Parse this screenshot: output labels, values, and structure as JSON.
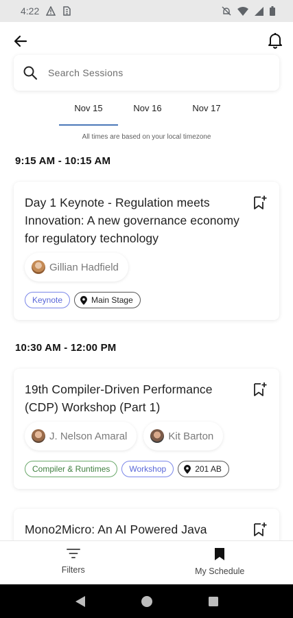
{
  "status_bar": {
    "time": "4:22"
  },
  "search": {
    "placeholder": "Search Sessions"
  },
  "date_tabs": [
    {
      "label": "Nov 15",
      "active": true
    },
    {
      "label": "Nov 16",
      "active": false
    },
    {
      "label": "Nov 17",
      "active": false
    }
  ],
  "timezone_note": "All times are based on your local timezone",
  "slots": [
    {
      "time": "9:15 AM - 10:15 AM",
      "session": {
        "title": "Day 1 Keynote - Regulation meets Innovation: A new governance economy for regulatory technology",
        "speakers": [
          "Gillian Hadfield"
        ],
        "tags": [
          {
            "label": "Keynote",
            "kind": "track"
          }
        ],
        "location": "Main Stage"
      }
    },
    {
      "time": "10:30 AM - 12:00 PM",
      "session": {
        "title": "19th Compiler-Driven Performance (CDP) Workshop (Part 1)",
        "speakers": [
          "J. Nelson Amaral",
          "Kit Barton"
        ],
        "tags": [
          {
            "label": "Compiler & Runtimes",
            "kind": "topic"
          },
          {
            "label": "Workshop",
            "kind": "track"
          }
        ],
        "location": "201 AB"
      }
    },
    {
      "session": {
        "title": "Mono2Micro: An AI Powered Java"
      }
    }
  ],
  "bottom_nav": [
    {
      "label": "Filters",
      "icon": "filter-icon"
    },
    {
      "label": "My Schedule",
      "icon": "bookmark-icon"
    }
  ],
  "colors": {
    "accent": "#4a78b8",
    "track_tag": "#5866d8",
    "topic_tag": "#3f7f3f",
    "status_bar_bg": "#e9e9e9"
  }
}
